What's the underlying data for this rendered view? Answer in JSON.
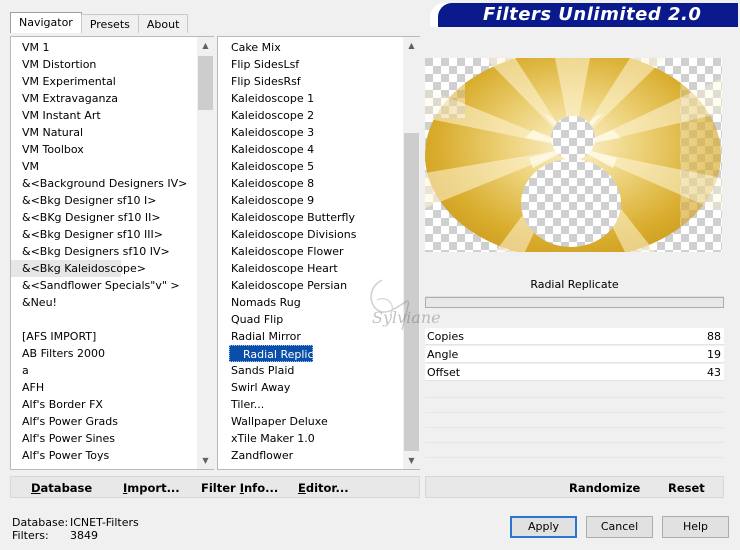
{
  "tabs": [
    "Navigator",
    "Presets",
    "About"
  ],
  "brand": "Filters Unlimited 2.0",
  "categories": [
    "VM 1",
    "VM Distortion",
    "VM Experimental",
    "VM Extravaganza",
    "VM Instant Art",
    "VM Natural",
    "VM Toolbox",
    "VM",
    "&<Background Designers IV>",
    "&<Bkg Designer sf10 I>",
    "&<BKg Designer sf10 II>",
    "&<Bkg Designer sf10 III>",
    "&<Bkg Designers sf10 IV>",
    "&<Bkg Kaleidoscope>",
    "&<Sandflower Specials\"v\" >",
    "&Neu!",
    "",
    "[AFS IMPORT]",
    "AB Filters 2000",
    "a",
    "AFH",
    "Alf's Border FX",
    "Alf's Power Grads",
    "Alf's Power Sines",
    "Alf's Power Toys"
  ],
  "highlighted_category": "&<Bkg Kaleidoscope>",
  "filters": [
    "Cake Mix",
    "Flip SidesLsf",
    "Flip SidesRsf",
    "Kaleidoscope 1",
    "Kaleidoscope 2",
    "Kaleidoscope 3",
    "Kaleidoscope 4",
    "Kaleidoscope 5",
    "Kaleidoscope 8",
    "Kaleidoscope 9",
    "Kaleidoscope Butterfly",
    "Kaleidoscope Divisions",
    "Kaleidoscope Flower",
    "Kaleidoscope Heart",
    "Kaleidoscope Persian",
    "Nomads Rug",
    "Quad Flip",
    "Radial Mirror",
    "Radial Replicate",
    "Sands Plaid",
    "Swirl Away",
    "Tiler...",
    "Wallpaper Deluxe",
    "xTile Maker 1.0",
    "Zandflower"
  ],
  "selected_filter": "Radial Replicate",
  "params_title": "Radial Replicate",
  "params": [
    {
      "label": "Copies",
      "value": "88"
    },
    {
      "label": "Angle",
      "value": "19"
    },
    {
      "label": "Offset",
      "value": "43"
    }
  ],
  "toolbar": {
    "database": {
      "u": "D",
      "rest": "atabase"
    },
    "import": {
      "u": "I",
      "rest": "mport..."
    },
    "filter_info": {
      "pre": "Filter ",
      "u": "I",
      "rest": "nfo..."
    },
    "editor": {
      "u": "E",
      "rest": "ditor..."
    },
    "randomize": "Randomize",
    "reset": "Reset"
  },
  "status": {
    "database_label": "Database:",
    "database_value": "ICNET-Filters",
    "filters_label": "Filters:",
    "filters_value": "3849"
  },
  "buttons": {
    "apply": "Apply",
    "cancel": "Cancel",
    "help": "Help"
  },
  "watermark": "Sylviane",
  "colors": {
    "selection": "#0a4ea8",
    "brand": "#0a1a8c",
    "gold": "#d6a82a"
  }
}
